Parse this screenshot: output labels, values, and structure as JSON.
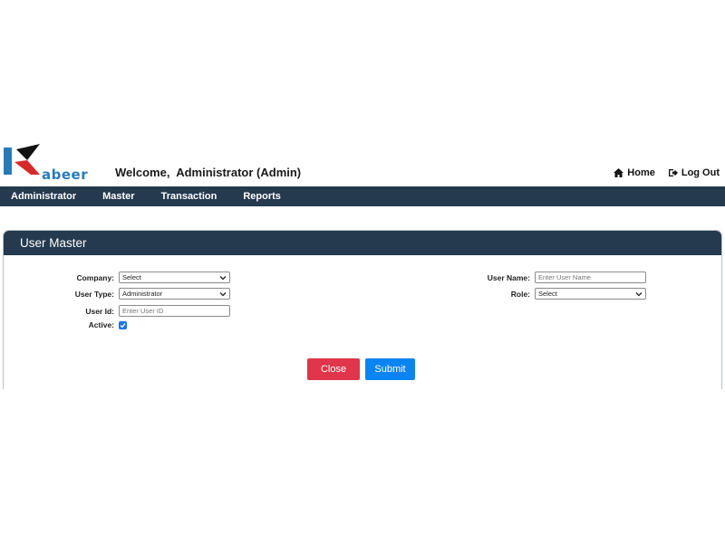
{
  "header": {
    "logo_text": "abeer",
    "welcome": "Welcome,  Administrator (Admin)",
    "home_label": "Home",
    "logout_label": "Log Out"
  },
  "nav": {
    "items": [
      {
        "label": "Administrator"
      },
      {
        "label": "Master"
      },
      {
        "label": "Transaction"
      },
      {
        "label": "Reports"
      }
    ]
  },
  "panel": {
    "title": "User Master",
    "fields": {
      "company": {
        "label": "Company:",
        "value": "Select"
      },
      "user_type": {
        "label": "User Type:",
        "value": "Administrator"
      },
      "user_id": {
        "label": "User Id:",
        "placeholder": "Enter User ID"
      },
      "active": {
        "label": "Active:",
        "checked": true
      },
      "user_name": {
        "label": "User Name:",
        "placeholder": "Enter User Name"
      },
      "role": {
        "label": "Role:",
        "value": "Select"
      }
    },
    "buttons": {
      "close": "Close",
      "submit": "Submit"
    }
  },
  "colors": {
    "nav_bg": "#253a4f",
    "close_btn": "#e0354a",
    "submit_btn": "#0b84f3",
    "logo_blue": "#2a7ab8",
    "logo_red": "#d62b2b"
  },
  "icons": {
    "home": "home-icon",
    "logout": "logout-icon"
  }
}
